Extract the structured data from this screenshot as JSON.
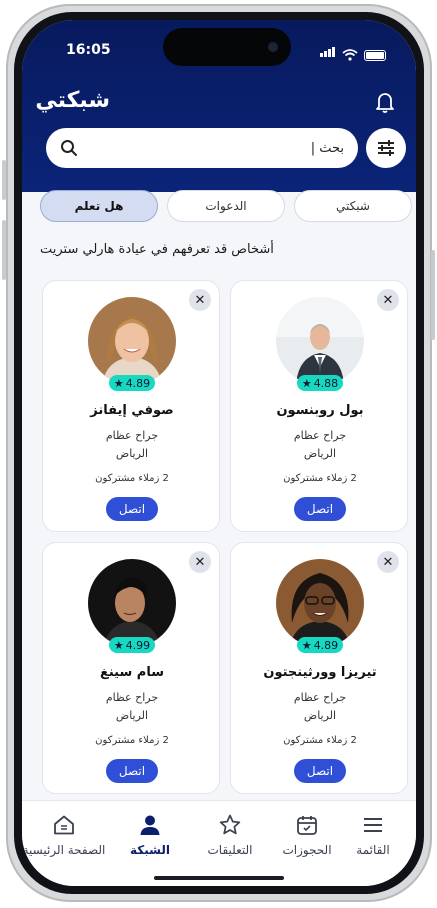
{
  "status_bar": {
    "time": "16:05"
  },
  "header": {
    "title": "شبكتي",
    "bell_icon": "bell-icon"
  },
  "search": {
    "value": "بحث |",
    "icon": "search-icon",
    "filter_icon": "filter-sliders-icon"
  },
  "tabs": [
    {
      "label": "شبكتي",
      "active": false
    },
    {
      "label": "الدعوات",
      "active": false
    },
    {
      "label": "هل تعلم",
      "active": true
    }
  ],
  "section_title": "أشخاص قد تعرفهم في عيادة هارلي ستريت",
  "cards": [
    {
      "name": "بول روبنسون",
      "role": "جراح عظام",
      "city": "الرياض",
      "mutual": "2 زملاء مشتركون",
      "rating": "4.88",
      "connect_label": "اتصل"
    },
    {
      "name": "صوفي إيفانز",
      "role": "جراح عظام",
      "city": "الرياض",
      "mutual": "2 زملاء مشتركون",
      "rating": "4.89",
      "connect_label": "اتصل"
    },
    {
      "name": "تيريزا وورثينجتون",
      "role": "جراح عظام",
      "city": "الرياض",
      "mutual": "2 زملاء مشتركون",
      "rating": "4.89",
      "connect_label": "اتصل"
    },
    {
      "name": "سام سينغ",
      "role": "جراح عظام",
      "city": "الرياض",
      "mutual": "2 زملاء مشتركون",
      "rating": "4.99",
      "connect_label": "اتصل"
    }
  ],
  "bottom_nav": [
    {
      "label": "القائمة",
      "icon": "menu-icon",
      "active": false
    },
    {
      "label": "الحجوزات",
      "icon": "calendar-icon",
      "active": false
    },
    {
      "label": "التعليقات",
      "icon": "star-icon",
      "active": false
    },
    {
      "label": "الشبكة",
      "icon": "person-icon",
      "active": true
    },
    {
      "label": "الصفحة الرئيسية",
      "icon": "home-icon",
      "active": false
    }
  ],
  "colors": {
    "header": "#0b2478",
    "accent": "#2f4fd6",
    "rating_badge": "#17d9c0"
  }
}
